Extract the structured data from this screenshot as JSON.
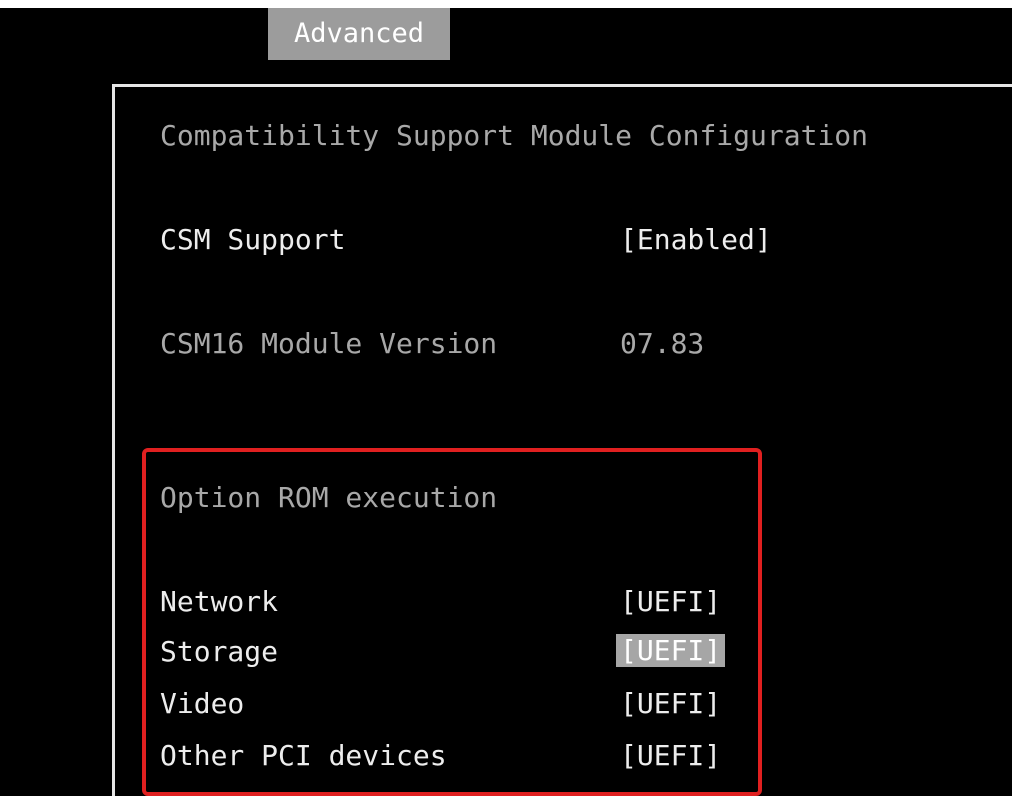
{
  "tabs": {
    "active_label": "Advanced"
  },
  "csm": {
    "title": "Compatibility Support Module Configuration",
    "support_label": "CSM Support",
    "support_value": "[Enabled]",
    "version_label": "CSM16 Module Version",
    "version_value": "07.83"
  },
  "option_rom": {
    "title": "Option ROM execution",
    "items": [
      {
        "label": "Network",
        "value": "[UEFI]"
      },
      {
        "label": "Storage",
        "value": "[UEFI]"
      },
      {
        "label": "Video",
        "value": "[UEFI]"
      },
      {
        "label": "Other PCI devices",
        "value": "[UEFI]"
      }
    ]
  },
  "colors": {
    "background": "#000000",
    "highlight_border": "#e02020",
    "selection": "#a6a6a6"
  }
}
